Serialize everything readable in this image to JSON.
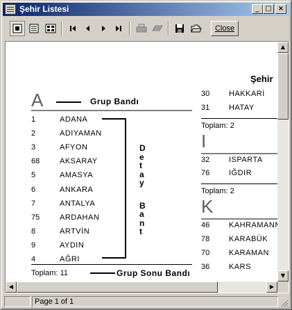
{
  "window": {
    "title": "Şehir Listesi"
  },
  "toolbar": {
    "icons": [
      "page-width-icon",
      "full-page-icon",
      "multi-page-icon",
      "first-page-icon",
      "prev-page-icon",
      "next-page-icon",
      "last-page-icon",
      "print-setup-icon",
      "print-icon",
      "save-icon",
      "open-icon"
    ],
    "close_label": "Close"
  },
  "report": {
    "title": "Şehir",
    "annotations": {
      "group_band": "Grup Bandı",
      "detail_band": "Detay Bant",
      "group_footer_band": "Grup Sonu Bandı"
    },
    "left_group": {
      "letter": "A",
      "rows": [
        {
          "code": "1",
          "name": "ADANA"
        },
        {
          "code": "2",
          "name": "ADIYAMAN"
        },
        {
          "code": "3",
          "name": "AFYON"
        },
        {
          "code": "68",
          "name": "AKSARAY"
        },
        {
          "code": "5",
          "name": "AMASYA"
        },
        {
          "code": "6",
          "name": "ANKARA"
        },
        {
          "code": "7",
          "name": "ANTALYA"
        },
        {
          "code": "75",
          "name": "ARDAHAN"
        },
        {
          "code": "8",
          "name": "ARTVİN"
        },
        {
          "code": "9",
          "name": "AYDIN"
        },
        {
          "code": "4",
          "name": "AĞRI"
        }
      ],
      "total": "Toplam: 11"
    },
    "right_groups": [
      {
        "letter": "",
        "rows": [
          {
            "code": "30",
            "name": "HAKKARİ"
          },
          {
            "code": "31",
            "name": "HATAY"
          }
        ],
        "total": "Toplam: 2"
      },
      {
        "letter": "I",
        "rows": [
          {
            "code": "32",
            "name": "ISPARTA"
          },
          {
            "code": "76",
            "name": "IĞDIR"
          }
        ],
        "total": "Toplam: 2"
      },
      {
        "letter": "K",
        "rows": [
          {
            "code": "46",
            "name": "KAHRAMANMARAŞ"
          },
          {
            "code": "78",
            "name": "KARABÜK"
          },
          {
            "code": "70",
            "name": "KARAMAN"
          },
          {
            "code": "36",
            "name": "KARS"
          }
        ],
        "total": ""
      }
    ]
  },
  "status": {
    "page_info": "Page 1 of 1"
  }
}
